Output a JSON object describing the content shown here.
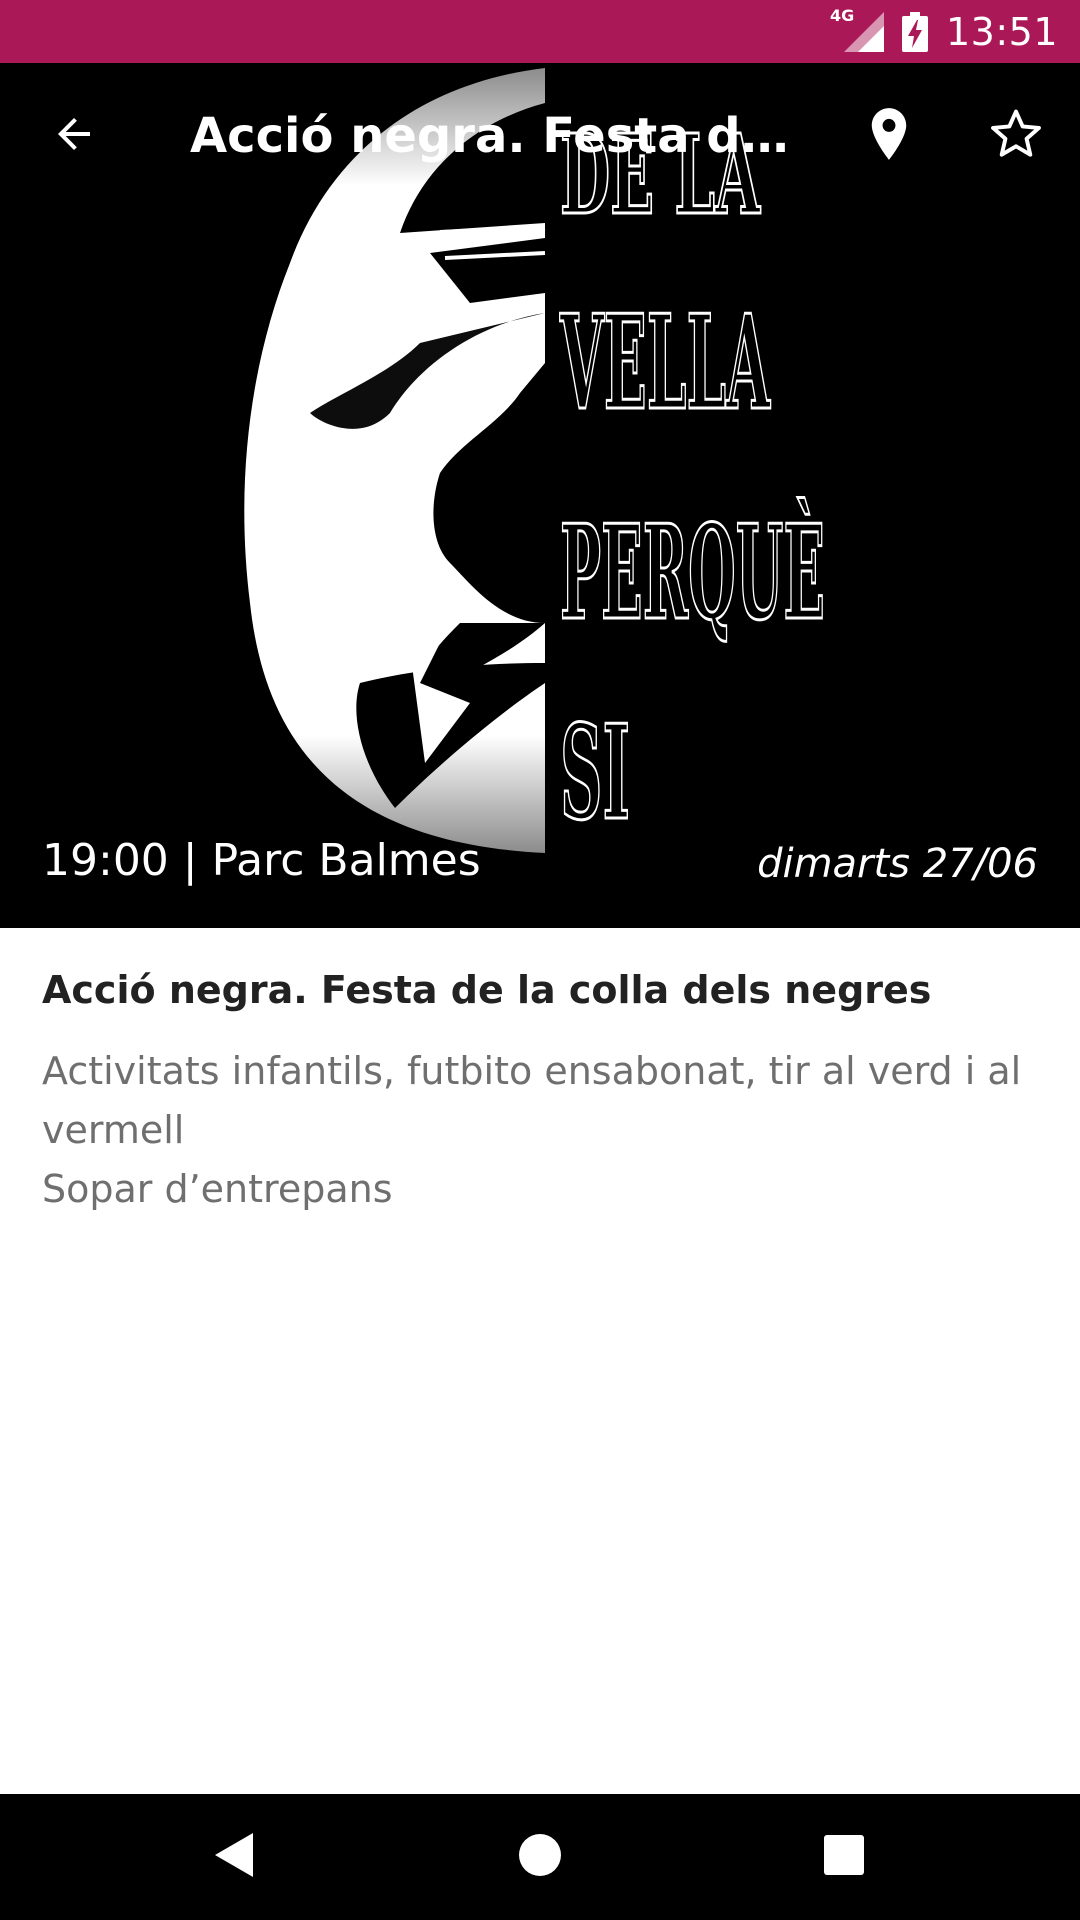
{
  "status_bar": {
    "network": "4G",
    "time": "13:51",
    "background": "#ab1857"
  },
  "toolbar": {
    "title": "Acció negra. Festa de la colla dels negres",
    "back_icon": "arrow-back-icon",
    "location_icon": "location-pin-icon",
    "favorite_icon": "star-outline-icon"
  },
  "hero": {
    "poster_text": [
      "DE LA",
      "VELLA",
      "PERQUÈ",
      "SI"
    ],
    "time_place": "19:00 | Parc Balmes",
    "date": "dimarts 27/06"
  },
  "event": {
    "title": "Acció negra. Festa de la colla dels negres",
    "description_lines": [
      "Activitats infantils, futbito ensabonat, tir al verd i al vermell",
      "Sopar d’entrepans"
    ]
  },
  "nav_bar": {
    "back_icon": "nav-back-triangle-icon",
    "home_icon": "nav-home-circle-icon",
    "recents_icon": "nav-recents-square-icon"
  }
}
